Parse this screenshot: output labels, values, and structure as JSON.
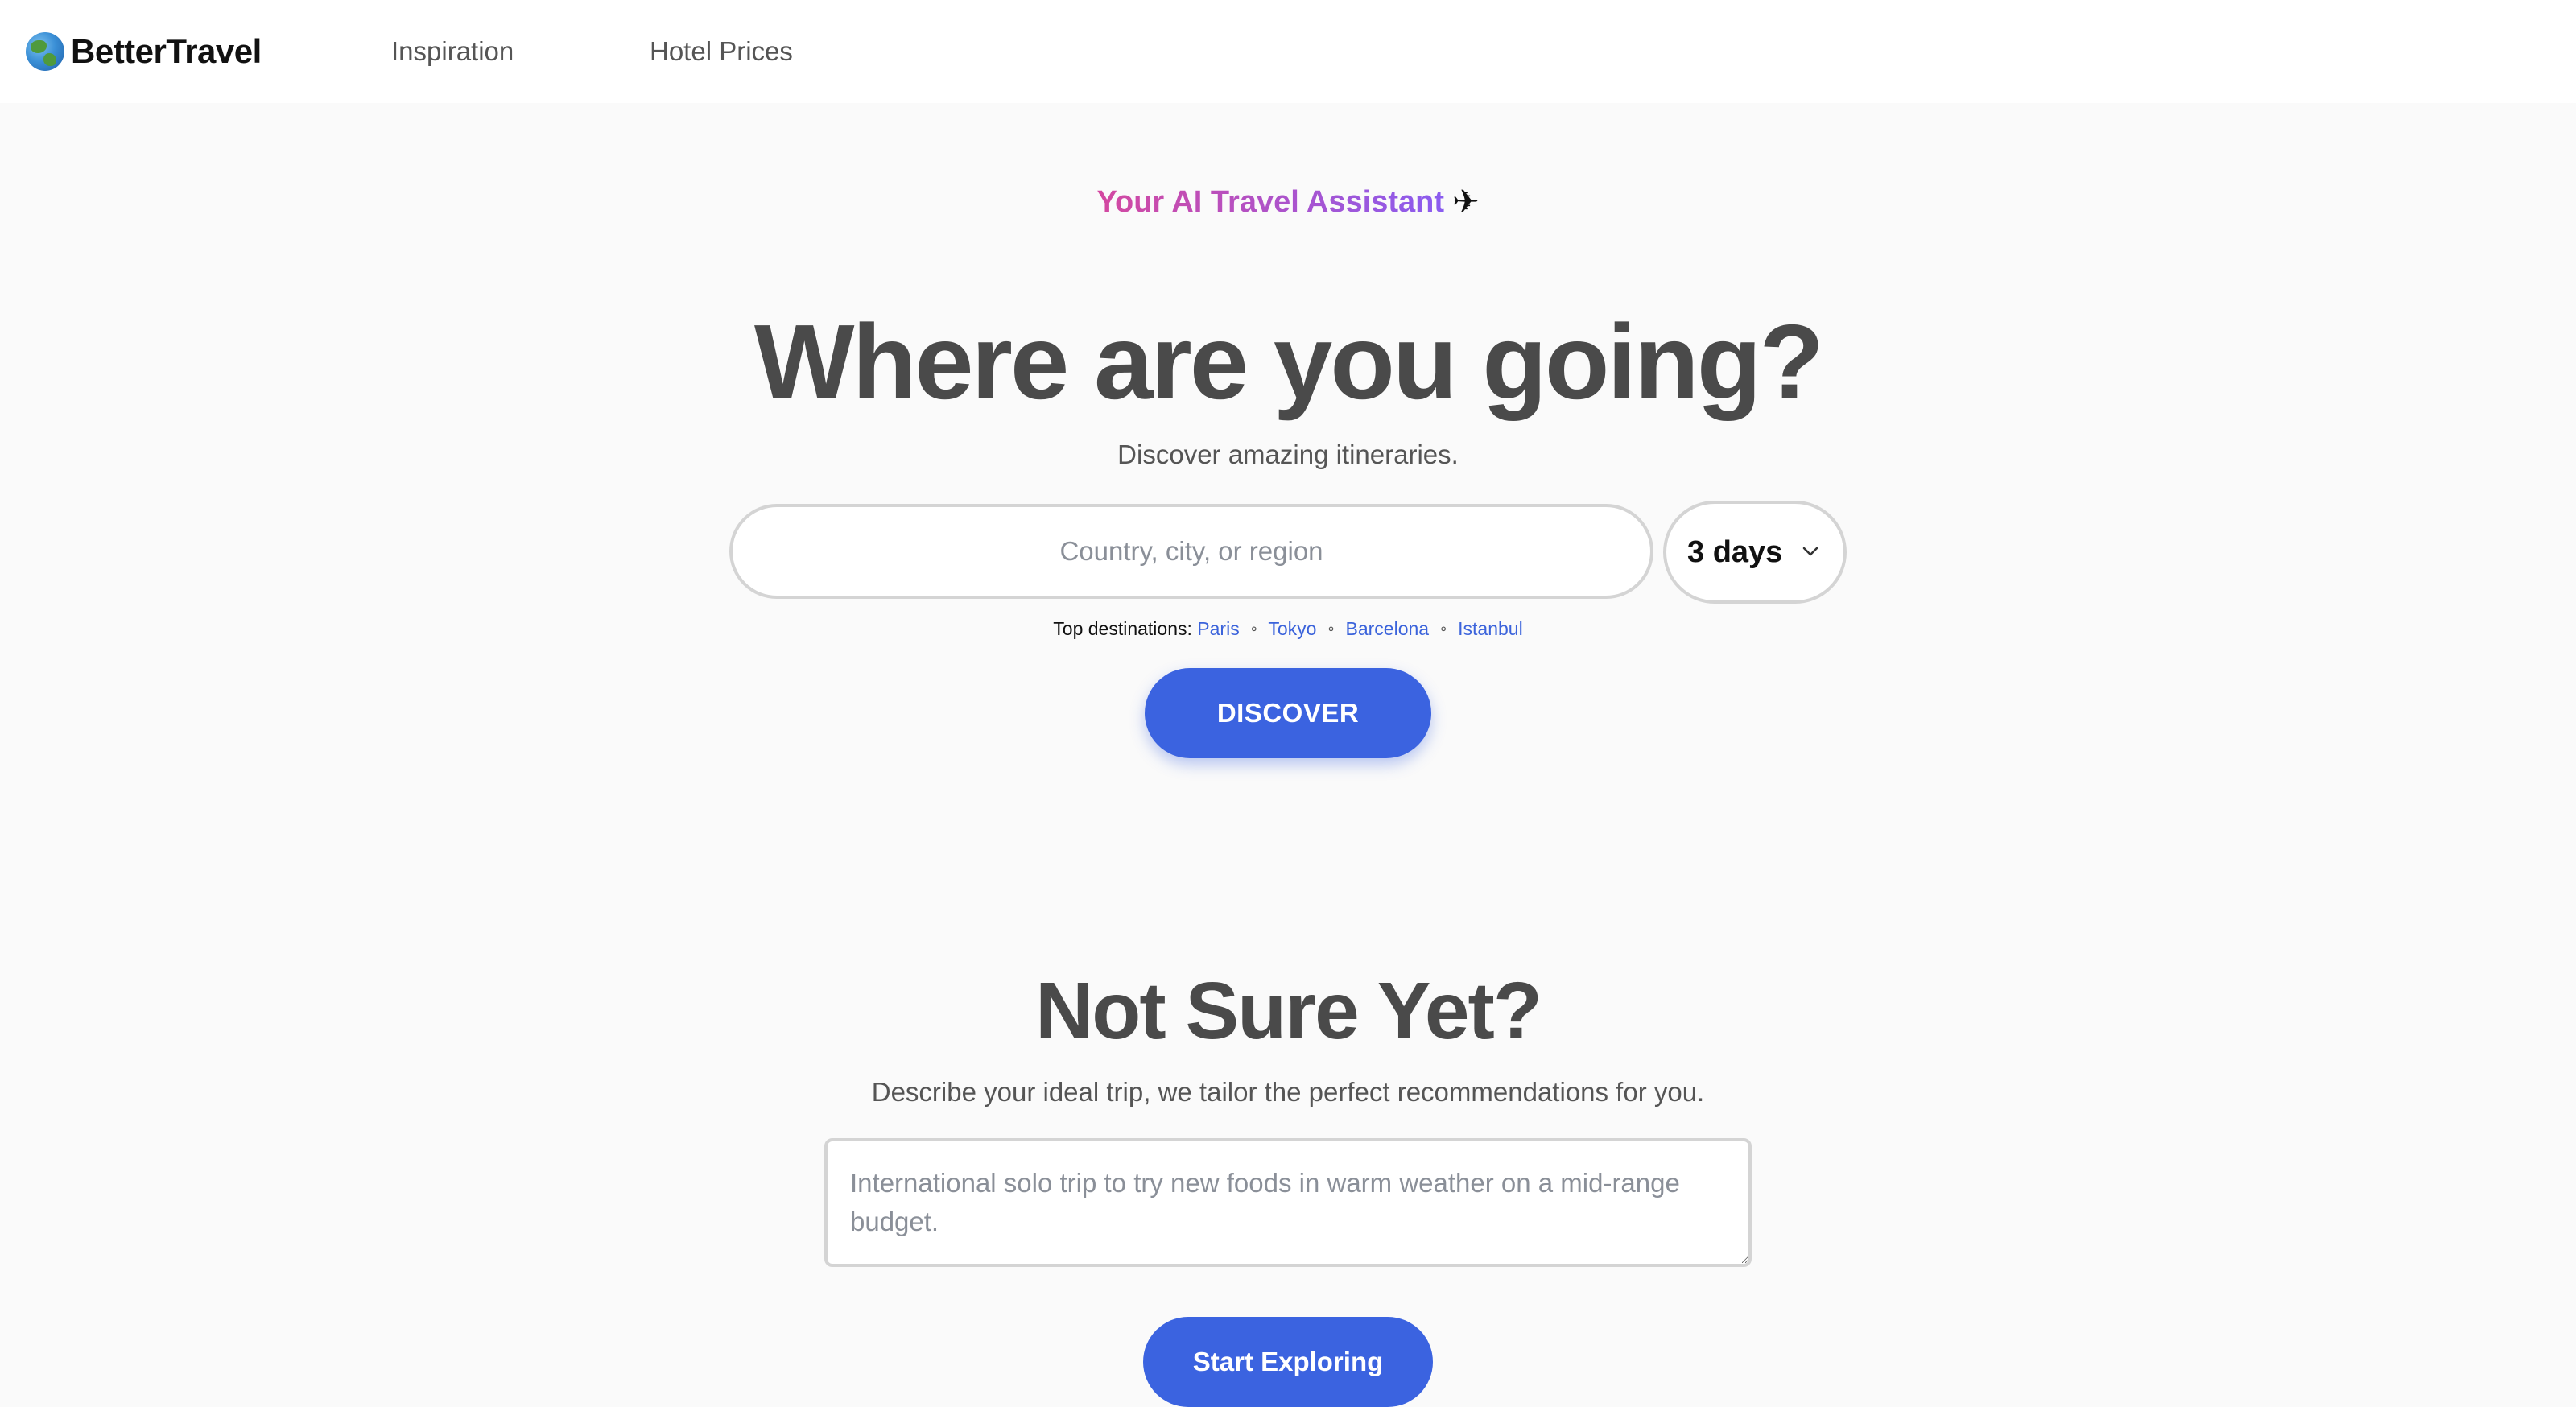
{
  "header": {
    "brand": "BetterTravel",
    "nav": [
      "Inspiration",
      "Hotel Prices"
    ]
  },
  "hero": {
    "tagline": "Your AI Travel Assistant",
    "plane_icon": "✈",
    "title": "Where are you going?",
    "subtitle": "Discover amazing itineraries.",
    "search_placeholder": "Country, city, or region",
    "search_value": "",
    "days_selected": "3 days",
    "top_destinations_label": "Top destinations:",
    "destinations": [
      "Paris",
      "Tokyo",
      "Barcelona",
      "Istanbul"
    ],
    "separator": "∘",
    "discover_label": "DISCOVER"
  },
  "not_sure": {
    "title": "Not Sure Yet?",
    "subtitle": "Describe your ideal trip, we tailor the perfect recommendations for you.",
    "textarea_placeholder": "International solo trip to try new foods in warm weather on a mid-range budget.",
    "textarea_value": "",
    "button_label": "Start Exploring"
  },
  "colors": {
    "accent": "#3b63e0",
    "link": "#3b63db",
    "tagline_gradient_start": "#d448a0",
    "tagline_gradient_end": "#8a5cf0",
    "page_bg": "#fafafa"
  },
  "icons": {
    "logo": "globe-icon",
    "tagline": "airplane-icon",
    "select": "chevron-down-icon"
  }
}
